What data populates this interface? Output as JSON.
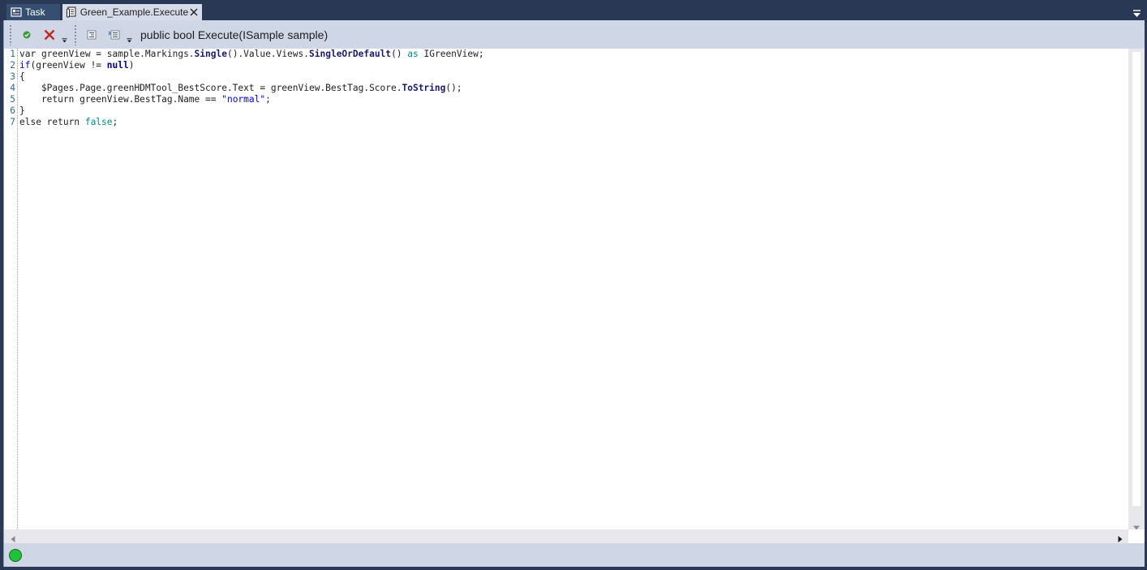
{
  "tabs": [
    {
      "label": "Task",
      "icon": "task-icon",
      "active": false
    },
    {
      "label": "Green_Example.Execute",
      "icon": "script-document-icon",
      "active": true,
      "closable": true
    }
  ],
  "toolbar": {
    "buttons": [
      {
        "name": "validate-button",
        "icon": "green-check-icon"
      },
      {
        "name": "delete-button",
        "icon": "red-x-icon"
      },
      {
        "name": "indent-button",
        "icon": "indent-lines-icon"
      },
      {
        "name": "comment-button",
        "icon": "comment-lines-icon"
      }
    ],
    "signature": "public bool Execute(ISample sample)"
  },
  "editor": {
    "lines": [
      {
        "num": "1",
        "tokens": [
          {
            "t": "var greenView = sample.Markings.",
            "c": "default"
          },
          {
            "t": "Single",
            "c": "method"
          },
          {
            "t": "().Value.Views.",
            "c": "default"
          },
          {
            "t": "SingleOrDefault",
            "c": "method"
          },
          {
            "t": "() ",
            "c": "default"
          },
          {
            "t": "as",
            "c": "literal"
          },
          {
            "t": " IGreenView;",
            "c": "default"
          }
        ]
      },
      {
        "num": "2",
        "tokens": [
          {
            "t": "if",
            "c": "keyword"
          },
          {
            "t": "(greenView != ",
            "c": "default"
          },
          {
            "t": "null",
            "c": "keyword-bold"
          },
          {
            "t": ")",
            "c": "default"
          }
        ]
      },
      {
        "num": "3",
        "tokens": [
          {
            "t": "{",
            "c": "default"
          }
        ]
      },
      {
        "num": "4",
        "tokens": [
          {
            "t": "    $Pages.Page.greenHDMTool_BestScore.Text = greenView.BestTag.Score.",
            "c": "default"
          },
          {
            "t": "ToString",
            "c": "method"
          },
          {
            "t": "();",
            "c": "default"
          }
        ]
      },
      {
        "num": "5",
        "tokens": [
          {
            "t": "    return greenView.BestTag.Name == ",
            "c": "default"
          },
          {
            "t": "\"normal\"",
            "c": "string"
          },
          {
            "t": ";",
            "c": "default"
          }
        ]
      },
      {
        "num": "6",
        "tokens": [
          {
            "t": "}",
            "c": "default"
          }
        ]
      },
      {
        "num": "7",
        "tokens": [
          {
            "t": "else return ",
            "c": "default"
          },
          {
            "t": "false",
            "c": "literal"
          },
          {
            "t": ";",
            "c": "default"
          }
        ]
      }
    ]
  },
  "status": {
    "indicator": "green-status-dot",
    "indicator_color": "#22c13a"
  }
}
